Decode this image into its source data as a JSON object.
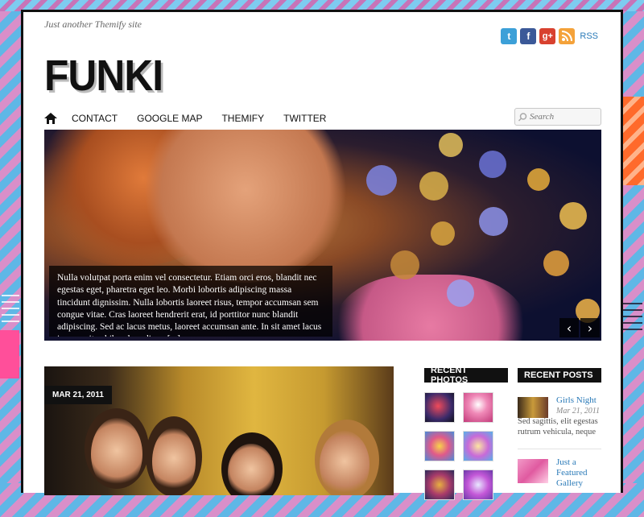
{
  "site": {
    "tagline": "Just another Themify site",
    "logo": "FUNKI"
  },
  "social": {
    "icons": [
      "twitter-icon",
      "facebook-icon",
      "google-plus-icon",
      "rss-icon"
    ],
    "rss_label": "RSS"
  },
  "nav": {
    "items": [
      "CONTACT",
      "GOOGLE MAP",
      "THEMIFY",
      "TWITTER"
    ],
    "search_placeholder": "Search"
  },
  "slider": {
    "caption": "Nulla volutpat porta enim vel consectetur. Etiam orci eros, blandit nec egestas eget, pharetra eget leo. Morbi lobortis adipiscing massa tincidunt dignissim. Nulla lobortis laoreet risus, tempor accumsan sem congue vitae. Cras laoreet hendrerit erat, id porttitor nunc blandit adipiscing. Sed ac lacus metus, laoreet accumsan ante. In sit amet lacus ipsum, vitae bibendum diam. [...]",
    "prev_symbol": "‹",
    "next_symbol": "›"
  },
  "post": {
    "date": "MAR 21, 2011"
  },
  "sidebar": {
    "recent_photos_title": "RECENT PHOTOS",
    "recent_posts_title": "RECENT POSTS",
    "recent_posts": [
      {
        "title": "Girls Night",
        "date": "Mar 21, 2011",
        "excerpt": "Sed sagittis, elit egestas rutrum vehicula, neque"
      },
      {
        "title": "Just a Featured Gallery",
        "date": "",
        "excerpt": ""
      }
    ]
  },
  "colors": {
    "accent_link": "#2a7ab8",
    "twitter": "#3ca0d8",
    "facebook": "#3b5998",
    "google_plus": "#d8412f",
    "rss": "#f4a23a"
  }
}
